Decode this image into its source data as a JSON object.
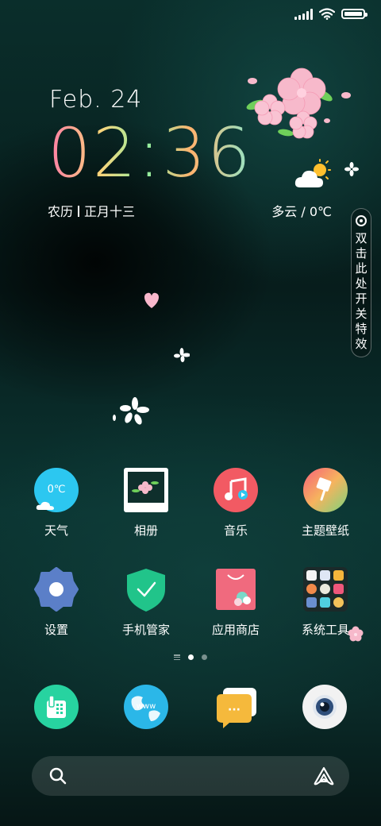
{
  "status_bar": {
    "icons": [
      "signal-icon",
      "wifi-icon",
      "battery-icon"
    ]
  },
  "clock_widget": {
    "date": "Feb. 24",
    "time": "02:36",
    "lunar_prefix": "农历",
    "lunar_date": "正月十三",
    "weather": "多云 / 0℃"
  },
  "effect_toggle": {
    "label": "双击此处开关特效"
  },
  "apps": [
    {
      "label": "天气",
      "icon": "weather-icon",
      "icon_text": "0℃"
    },
    {
      "label": "相册",
      "icon": "gallery-icon"
    },
    {
      "label": "音乐",
      "icon": "music-icon"
    },
    {
      "label": "主题壁纸",
      "icon": "theme-icon"
    },
    {
      "label": "设置",
      "icon": "settings-icon"
    },
    {
      "label": "手机管家",
      "icon": "security-icon"
    },
    {
      "label": "应用商店",
      "icon": "app-store-icon"
    },
    {
      "label": "系统工具",
      "icon": "tools-folder-icon"
    }
  ],
  "pager": {
    "pages": 2,
    "current": 1
  },
  "dock": [
    {
      "icon": "phone-icon"
    },
    {
      "icon": "browser-icon",
      "icon_text": "www"
    },
    {
      "icon": "messages-icon",
      "icon_text": "···"
    },
    {
      "icon": "camera-icon"
    }
  ],
  "search_bar": {
    "icons": [
      "search-icon",
      "assistant-icon"
    ]
  },
  "colors": {
    "weather_icon": "#2cc7f0",
    "music_icon": "#f25a63",
    "security_icon": "#21c48a",
    "store_icon": "#f06a7e",
    "settings_icon": "#5b7fc8",
    "phone_icon": "#27d3a0",
    "browser_icon": "#2bb7e8",
    "messages_icon": "#f5b93c"
  }
}
